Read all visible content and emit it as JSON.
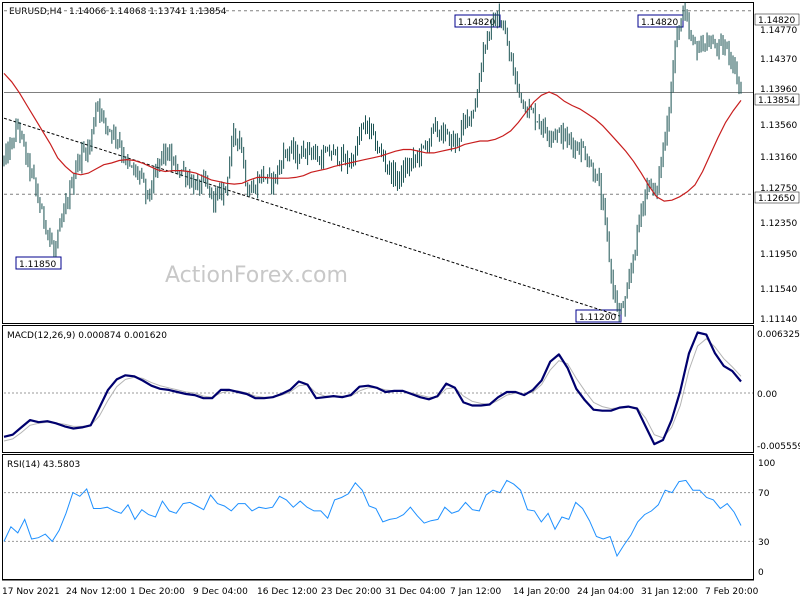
{
  "header": {
    "symbol": "EURUSD,H4",
    "ohlc": "1.14066 1.14068 1.13741 1.13854"
  },
  "watermark": "ActionForex.com",
  "colors": {
    "candle": "#1a5252",
    "ma": "#c81e1e",
    "macd_line": "#00006e",
    "macd_signal": "#b4b4b4",
    "rsi": "#1e90ff",
    "label_border": "#00008c",
    "level_line": "#808080",
    "trend_line": "#000000"
  },
  "chart_data": [
    {
      "type": "candlestick",
      "title": "EURUSD,H4 1.14066 1.14068 1.13741 1.13854",
      "ylim": [
        1.1114,
        1.149
      ],
      "y_ticks": [
        "1.14770",
        "1.14370",
        "1.13960",
        "1.13560",
        "1.13160",
        "1.12750",
        "1.12350",
        "1.11950",
        "1.11540",
        "1.11140"
      ],
      "x_ticks": [
        "17 Nov 2021",
        "24 Nov 12:00",
        "1 Dec 20:00",
        "9 Dec 04:00",
        "16 Dec 12:00",
        "23 Dec 20:00",
        "31 Dec 04:00",
        "7 Jan 12:00",
        "14 Jan 20:00",
        "24 Jan 04:00",
        "31 Jan 12:00",
        "7 Feb 20:00"
      ],
      "levels": [
        {
          "value": 1.1482,
          "label": "1.14820",
          "style": "dashed"
        },
        {
          "value": 1.13854,
          "label": "1.13854",
          "style": "solid"
        },
        {
          "value": 1.1265,
          "label": "1.12650",
          "style": "dashed"
        }
      ],
      "annotations": [
        {
          "label": "1.11850",
          "value": 1.1185
        },
        {
          "label": "1.14820",
          "value": 1.1482
        },
        {
          "label": "1.14820",
          "value": 1.1482
        },
        {
          "label": "1.11200",
          "value": 1.112
        }
      ],
      "close_path": [
        1.1305,
        1.1322,
        1.1348,
        1.131,
        1.1285,
        1.125,
        1.1225,
        1.1195,
        1.123,
        1.1262,
        1.1298,
        1.1315,
        1.1322,
        1.1378,
        1.1348,
        1.134,
        1.133,
        1.1302,
        1.1292,
        1.1288,
        1.126,
        1.1282,
        1.1312,
        1.1312,
        1.1294,
        1.1294,
        1.1282,
        1.1272,
        1.128,
        1.1262,
        1.1262,
        1.1275,
        1.1333,
        1.1332,
        1.127,
        1.1272,
        1.129,
        1.128,
        1.1285,
        1.1312,
        1.1318,
        1.1308,
        1.1318,
        1.1318,
        1.1305,
        1.1312,
        1.1314,
        1.1308,
        1.1302,
        1.131,
        1.1344,
        1.1344,
        1.1322,
        1.1308,
        1.1292,
        1.1282,
        1.1294,
        1.1302,
        1.1312,
        1.1322,
        1.1342,
        1.1338,
        1.1332,
        1.1325,
        1.1342,
        1.1358,
        1.1375,
        1.1438,
        1.1462,
        1.1475,
        1.1455,
        1.1415,
        1.1385,
        1.1368,
        1.136,
        1.1348,
        1.1338,
        1.1338,
        1.1335,
        1.1328,
        1.1322,
        1.1318,
        1.1298,
        1.1282,
        1.1232,
        1.1158,
        1.1122,
        1.1142,
        1.1195,
        1.1245,
        1.1282,
        1.1262,
        1.1312,
        1.1372,
        1.1455,
        1.148,
        1.1445,
        1.1438,
        1.1445,
        1.1442,
        1.1438,
        1.1438,
        1.1418,
        1.1386
      ],
      "ma_path": [
        1.1408,
        1.1398,
        1.1385,
        1.137,
        1.1355,
        1.134,
        1.1325,
        1.1308,
        1.1298,
        1.129,
        1.1288,
        1.129,
        1.1295,
        1.13,
        1.1302,
        1.1305,
        1.1306,
        1.1305,
        1.1302,
        1.1298,
        1.1294,
        1.1292,
        1.1293,
        1.1293,
        1.1292,
        1.129,
        1.1286,
        1.1282,
        1.128,
        1.1278,
        1.1277,
        1.1278,
        1.1282,
        1.1285,
        1.1285,
        1.1284,
        1.1284,
        1.1284,
        1.1285,
        1.1287,
        1.1291,
        1.1293,
        1.1295,
        1.1298,
        1.13,
        1.1302,
        1.1304,
        1.1306,
        1.1308,
        1.131,
        1.1313,
        1.1316,
        1.1318,
        1.1318,
        1.1316,
        1.1314,
        1.1314,
        1.1316,
        1.1318,
        1.132,
        1.1324,
        1.1326,
        1.1328,
        1.1328,
        1.133,
        1.1334,
        1.134,
        1.135,
        1.1362,
        1.1374,
        1.1382,
        1.1386,
        1.1382,
        1.1375,
        1.137,
        1.1366,
        1.136,
        1.1354,
        1.1346,
        1.1336,
        1.1326,
        1.1316,
        1.1304,
        1.129,
        1.1275,
        1.1262,
        1.1257,
        1.1258,
        1.1262,
        1.1268,
        1.1276,
        1.1292,
        1.1312,
        1.1332,
        1.135,
        1.1364,
        1.1376
      ]
    },
    {
      "type": "line",
      "title": "MACD(12,26,9) 0.000874 0.001620",
      "ylim": [
        -0.005559,
        0.006325
      ],
      "y_ticks": [
        "0.006325",
        "0.00",
        "-0.005559"
      ],
      "series": [
        {
          "values": [
            -0.0042,
            -0.004,
            -0.0033,
            -0.0026,
            -0.0028,
            -0.0027,
            -0.0029,
            -0.0032,
            -0.0034,
            -0.0033,
            -0.0031,
            -0.0014,
            0.0003,
            0.0013,
            0.0017,
            0.0016,
            0.0012,
            0.0007,
            0.0004,
            0.0003,
            0.0001,
            -0.0001,
            -0.0002,
            -0.0005,
            -0.0005,
            0.0003,
            0.0003,
            0.0001,
            -0.0001,
            -0.0005,
            -0.0005,
            -0.0004,
            -0.0001,
            0.0003,
            0.0011,
            0.0008,
            -0.0005,
            -0.0004,
            -0.0003,
            -0.0004,
            -0.0002,
            0.0006,
            0.0007,
            0.0005,
            0.0001,
            0.0002,
            0.0002,
            -0.0001,
            -0.0004,
            -0.0006,
            -0.0003,
            0.0009,
            0.0005,
            -0.0009,
            -0.0012,
            -0.0012,
            -0.0011,
            -0.0004,
            0.0001,
            0.0001,
            -0.0002,
            0.0003,
            0.0012,
            0.003,
            0.0037,
            0.0024,
            0.0004,
            -0.0007,
            -0.0016,
            -0.0017,
            -0.0017,
            -0.0014,
            -0.0013,
            -0.0015,
            -0.0032,
            -0.0049,
            -0.0045,
            -0.0026,
            0.0002,
            0.0038,
            0.0058,
            0.0056,
            0.0038,
            0.0026,
            0.0021,
            0.0011
          ]
        },
        {
          "values": [
            -0.0046,
            -0.0044,
            -0.0038,
            -0.0031,
            -0.0029,
            -0.0028,
            -0.0029,
            -0.003,
            -0.0032,
            -0.0032,
            -0.0031,
            -0.0022,
            -0.0007,
            0.0006,
            0.0013,
            0.0015,
            0.0014,
            0.001,
            0.0007,
            0.0005,
            0.0003,
            0.0001,
            0.0,
            -0.0003,
            -0.0004,
            0.0,
            0.0002,
            0.0002,
            0.0,
            -0.0003,
            -0.0004,
            -0.0004,
            -0.0002,
            0.0001,
            0.0007,
            0.0008,
            0.0,
            -0.0003,
            -0.0003,
            -0.0003,
            -0.0003,
            0.0002,
            0.0005,
            0.0005,
            0.0003,
            0.0002,
            0.0002,
            0.0,
            -0.0002,
            -0.0004,
            -0.0004,
            0.0004,
            0.0005,
            -0.0003,
            -0.0008,
            -0.001,
            -0.0011,
            -0.0007,
            -0.0002,
            0.0,
            -0.0001,
            0.0001,
            0.0008,
            0.0022,
            0.0031,
            0.0028,
            0.0014,
            0.0002,
            -0.0009,
            -0.0013,
            -0.0015,
            -0.0014,
            -0.0013,
            -0.0014,
            -0.0024,
            -0.004,
            -0.0043,
            -0.0033,
            -0.0012,
            0.0022,
            0.0045,
            0.0052,
            0.0044,
            0.0033,
            0.0025,
            0.0016
          ]
        }
      ]
    },
    {
      "type": "line",
      "title": "RSI(14) 43.5803",
      "ylim": [
        0,
        100
      ],
      "y_ticks": [
        "100",
        "70",
        "30",
        "0"
      ],
      "levels": [
        70,
        30
      ],
      "series": [
        {
          "values": [
            30,
            42,
            37,
            48,
            32,
            33,
            36,
            30,
            39,
            53,
            70,
            67,
            73,
            57,
            57,
            58,
            55,
            53,
            60,
            48,
            56,
            52,
            50,
            63,
            55,
            53,
            61,
            62,
            59,
            56,
            68,
            61,
            59,
            55,
            61,
            61,
            55,
            58,
            57,
            58,
            67,
            64,
            58,
            63,
            58,
            55,
            55,
            49,
            64,
            66,
            69,
            78,
            72,
            59,
            57,
            46,
            48,
            49,
            52,
            58,
            51,
            45,
            47,
            48,
            58,
            53,
            55,
            62,
            56,
            55,
            68,
            72,
            70,
            80,
            77,
            72,
            56,
            55,
            46,
            53,
            40,
            50,
            48,
            62,
            57,
            47,
            34,
            32,
            34,
            18,
            27,
            35,
            46,
            52,
            55,
            60,
            72,
            70,
            79,
            80,
            72,
            72,
            66,
            64,
            57,
            61,
            54,
            43
          ]
        }
      ]
    }
  ]
}
